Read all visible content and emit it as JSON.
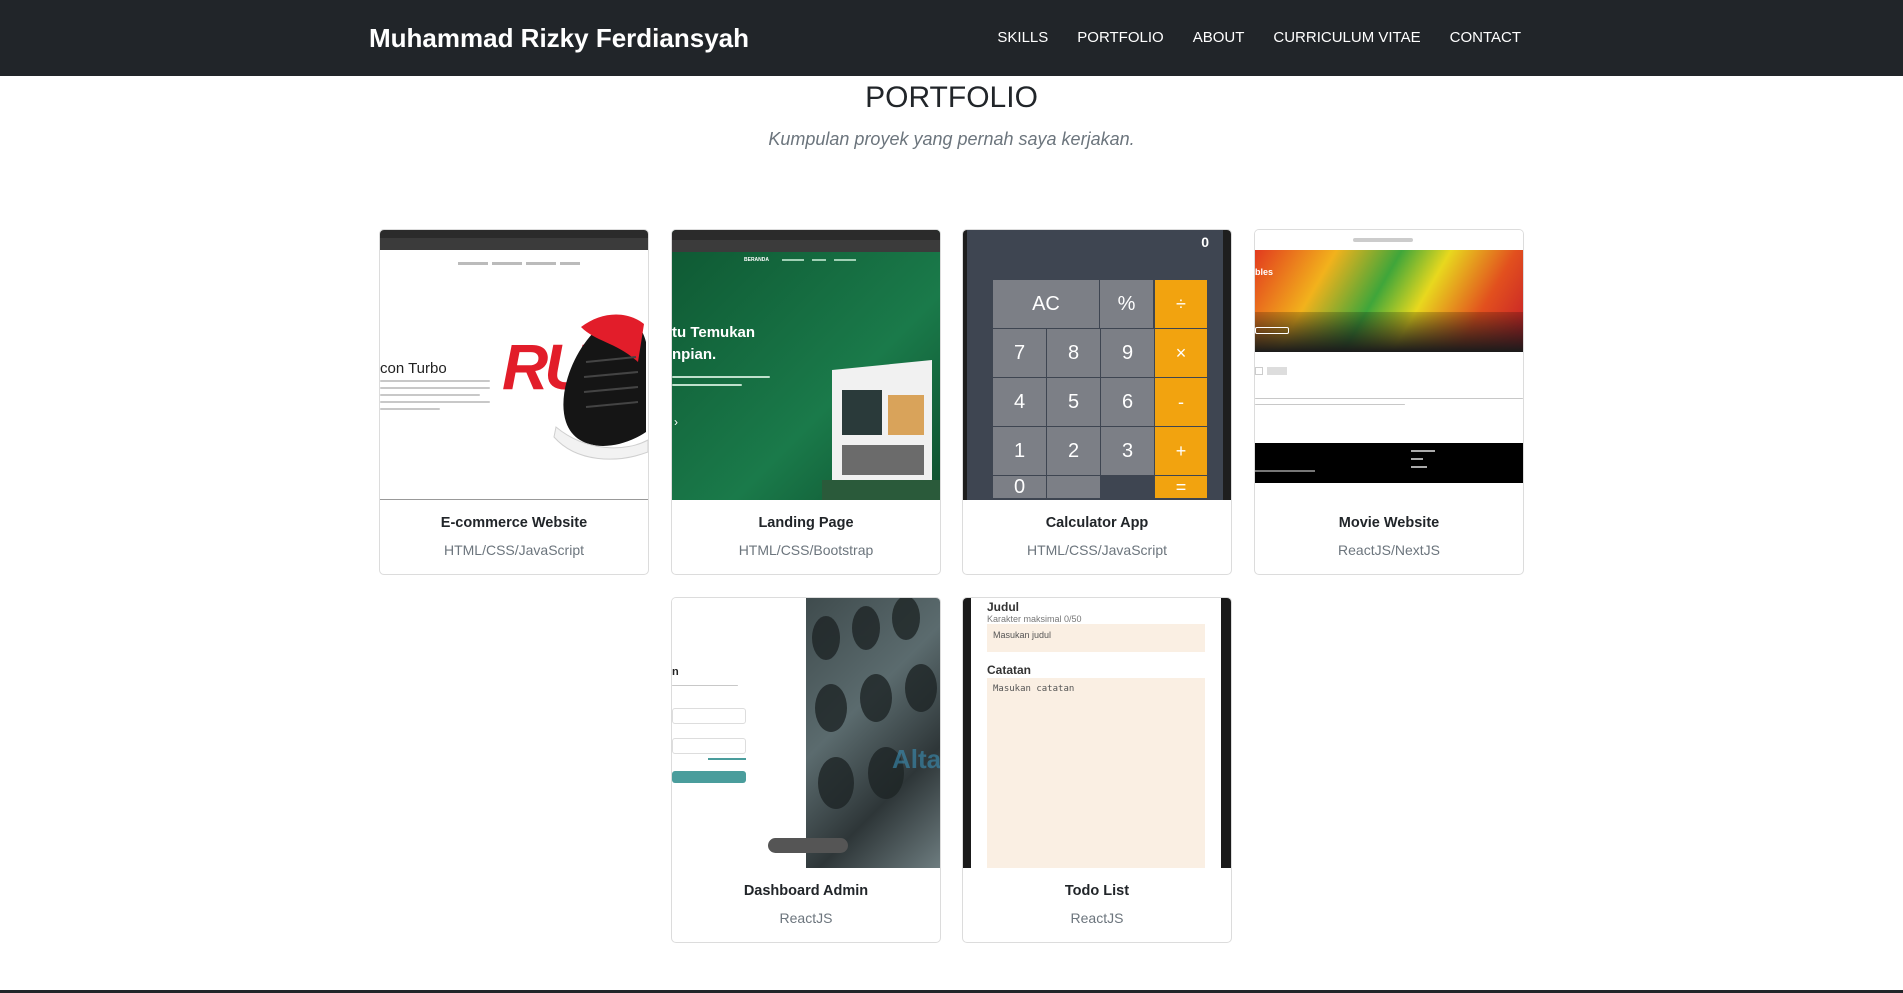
{
  "navbar": {
    "brand": "Muhammad Rizky Ferdiansyah",
    "links": [
      "SKILLS",
      "PORTFOLIO",
      "ABOUT",
      "CURRICULUM VITAE",
      "CONTACT"
    ]
  },
  "section": {
    "title": "PORTFOLIO",
    "subtitle": "Kumpulan proyek yang pernah saya kerjakan."
  },
  "projects": [
    {
      "title": "E-commerce Website",
      "tech": "HTML/CSS/JavaScript",
      "thumb": {
        "heading": "con Turbo",
        "wordmark": "RU"
      }
    },
    {
      "title": "Landing Page",
      "tech": "HTML/CSS/Bootstrap",
      "thumb": {
        "heading_1": "tu Temukan",
        "heading_2": "npian.",
        "nav_item": "BERANDA"
      }
    },
    {
      "title": "Calculator App",
      "tech": "HTML/CSS/JavaScript",
      "thumb": {
        "display": "0",
        "keys": [
          "AC",
          "%",
          "7",
          "8",
          "9",
          "4",
          "5",
          "6",
          "1",
          "2",
          "3",
          "0",
          ""
        ],
        "ops": [
          "÷",
          "×",
          "-",
          "+",
          "="
        ]
      }
    },
    {
      "title": "Movie Website",
      "tech": "ReactJS/NextJS",
      "thumb": {
        "heading": "bles"
      }
    },
    {
      "title": "Dashboard Admin",
      "tech": "ReactJS",
      "thumb": {
        "heading": "n",
        "watermark": "Alta"
      }
    },
    {
      "title": "Todo List",
      "tech": "ReactJS",
      "thumb": {
        "label_title": "Judul",
        "hint_title": "Karakter maksimal 0/50",
        "placeholder_title": "Masukan judul",
        "label_note": "Catatan",
        "placeholder_note": "Masukan catatan"
      }
    }
  ],
  "colors": {
    "navbar_bg": "#212529",
    "calc_operator": "#f2a30f",
    "landing_green": "#14663e",
    "todo_field": "#faefe3",
    "dashboard_button": "#4a9d9c"
  }
}
